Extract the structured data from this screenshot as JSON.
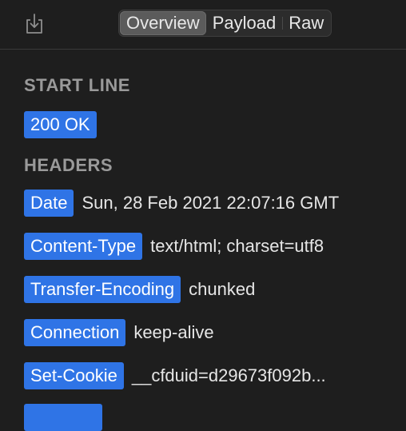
{
  "toolbar": {
    "export_icon": "download-tray-icon",
    "tabs": [
      {
        "label": "Overview",
        "active": true
      },
      {
        "label": "Payload",
        "active": false
      },
      {
        "label": "Raw",
        "active": false
      }
    ]
  },
  "start_line": {
    "title": "START LINE",
    "status": "200 OK"
  },
  "headers": {
    "title": "HEADERS",
    "items": [
      {
        "name": "Date",
        "value": "Sun, 28 Feb 2021 22:07:16 GMT"
      },
      {
        "name": "Content-Type",
        "value": "text/html; charset=utf8"
      },
      {
        "name": "Transfer-Encoding",
        "value": "chunked"
      },
      {
        "name": "Connection",
        "value": "keep-alive"
      },
      {
        "name": "Set-Cookie",
        "value": "__cfduid=d29673f092b..."
      }
    ]
  },
  "colors": {
    "background": "#1e1e1e",
    "pill": "#2f74e6",
    "section_title": "#9a9a9a"
  }
}
